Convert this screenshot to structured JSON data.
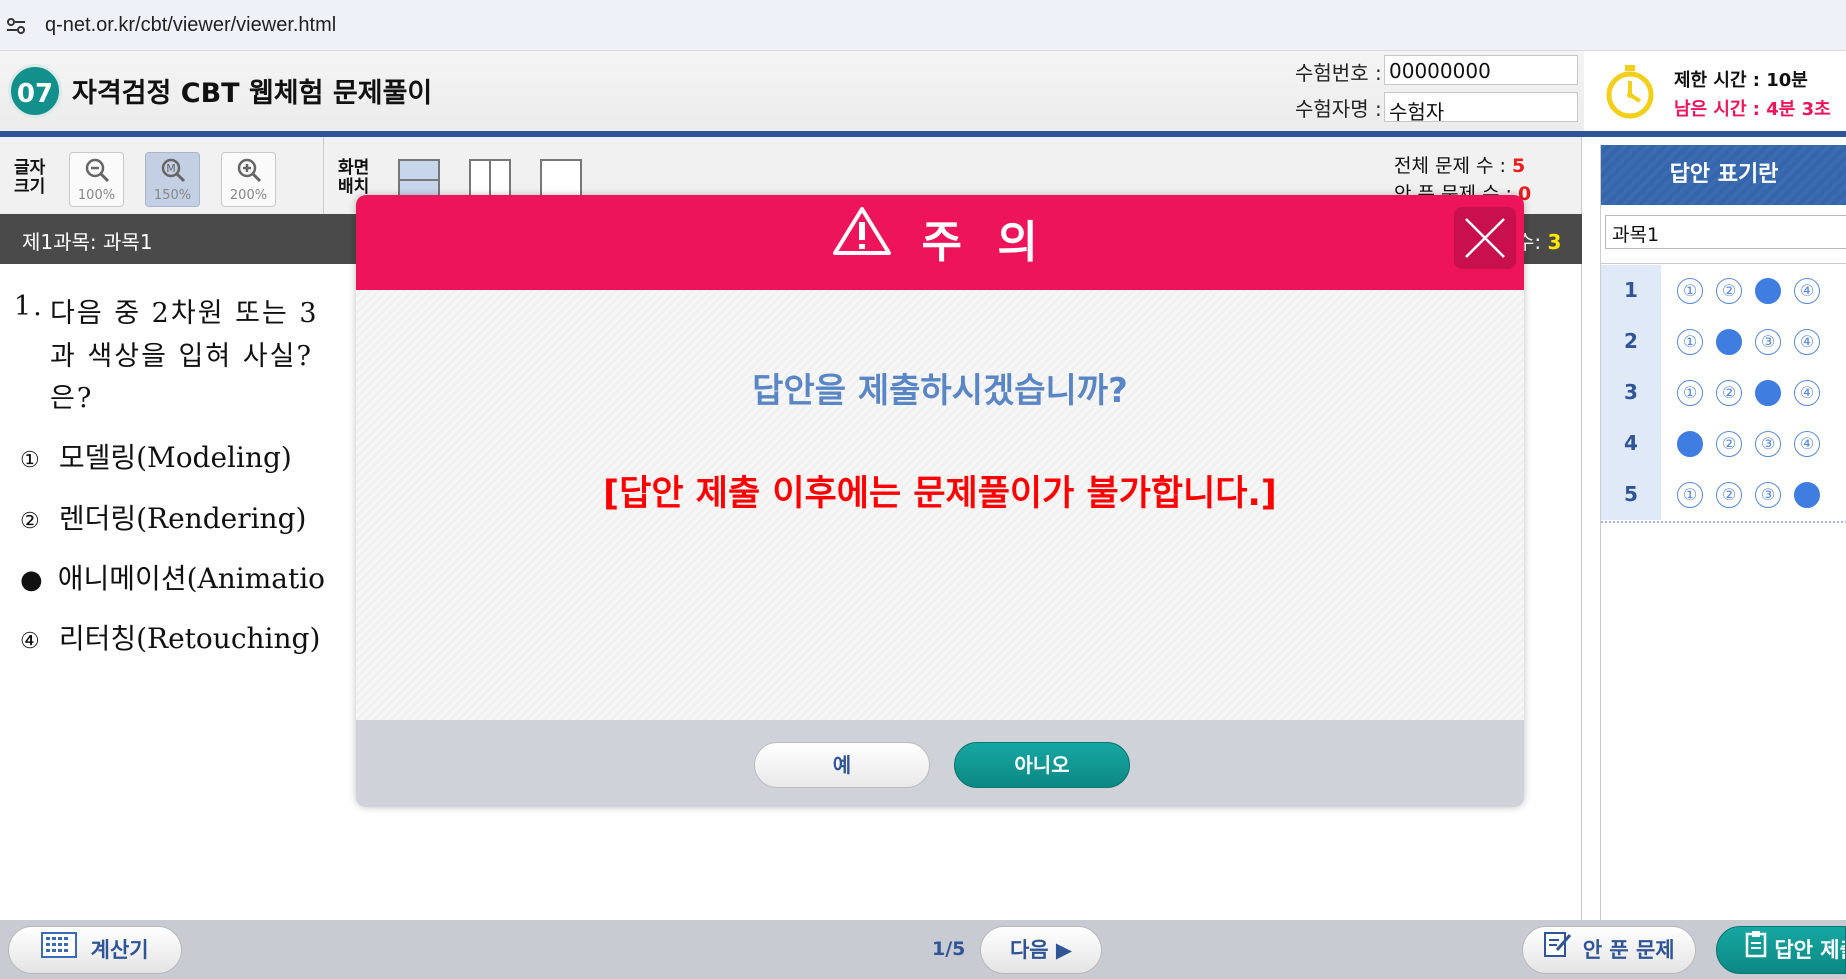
{
  "browser": {
    "url": "q-net.or.kr/cbt/viewer/viewer.html"
  },
  "header": {
    "badge": "07",
    "title": "자격검정 CBT 웹체험 문제풀이",
    "exam_no_label": "수험번호 :",
    "exam_no_value": "00000000",
    "examinee_label": "수험자명 :",
    "examinee_value": "수험자",
    "time_limit": "제한 시간 : 10분",
    "time_left": "남은 시간 : 4분 3초"
  },
  "toolbar": {
    "font_size_label_1": "글자",
    "font_size_label_2": "크기",
    "zoom_100": "100%",
    "zoom_150": "150%",
    "zoom_200": "200%",
    "layout_label_1": "화면",
    "layout_label_2": "배치",
    "total_questions_label": "전체 문제 수 :",
    "total_questions_value": "5",
    "unsolved_label": "안 푼 문제 수 :",
    "unsolved_value": "0"
  },
  "subject_bar": {
    "subject": "제1과목:  과목1",
    "right_label": "수:",
    "right_value": "3"
  },
  "question": {
    "number": "1.",
    "line1": "다음 중 2차원 또는 3",
    "line2": "과 색상을 입혀 사실?",
    "line3": "은?",
    "options": [
      {
        "num": "①",
        "text": "모델링(Modeling)"
      },
      {
        "num": "②",
        "text": "렌더링(Rendering)"
      },
      {
        "num": "●",
        "text": "애니메이션(Animatio"
      },
      {
        "num": "④",
        "text": "리터칭(Retouching)"
      }
    ]
  },
  "answer_panel": {
    "title": "답안 표기란",
    "subject": "과목1",
    "rows": [
      {
        "n": "1",
        "selected": 3
      },
      {
        "n": "2",
        "selected": 2
      },
      {
        "n": "3",
        "selected": 3
      },
      {
        "n": "4",
        "selected": 1
      },
      {
        "n": "5",
        "selected": 4
      }
    ],
    "option_labels": [
      "①",
      "②",
      "③",
      "④"
    ]
  },
  "bottom": {
    "calculator": "계산기",
    "page": "1/5",
    "next": "다음 ▶",
    "unsolved": "안 푼 문제",
    "submit": "답안 제출"
  },
  "dialog": {
    "title": "주 의",
    "message": "답안을 제출하시겠습니까?",
    "warning": "[답안 제출 이후에는 문제풀이가 불가합니다.]",
    "yes": "예",
    "no": "아니오"
  },
  "colors": {
    "brand_teal": "#11908c",
    "header_blue": "#2f5597",
    "dialog_red": "#ee145b",
    "answer_blue": "#3f7ee0",
    "warning_red": "#ff0000"
  }
}
